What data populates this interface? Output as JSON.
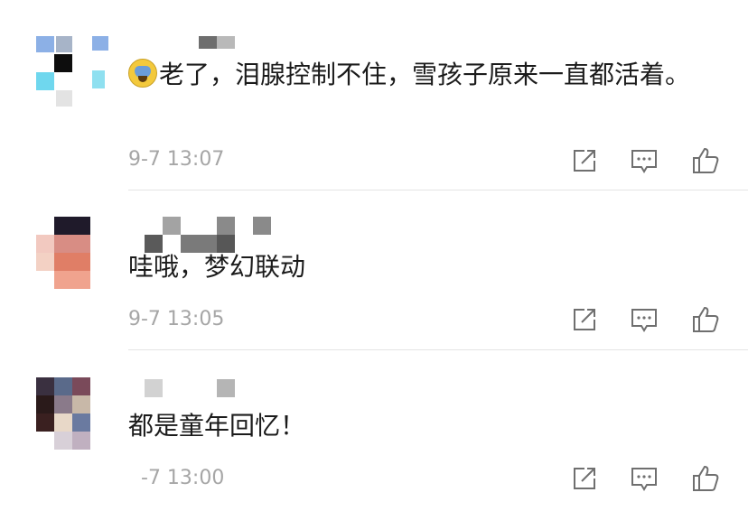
{
  "comments": [
    {
      "text": "老了，泪腺控制不住，雪孩子原来一直都活着。",
      "time": "9-7 13:07",
      "has_emoji": true,
      "emoji_icon": "crying-face-icon"
    },
    {
      "text": "哇哦，梦幻联动",
      "time": "9-7 13:05",
      "has_emoji": false
    },
    {
      "text": "都是童年回忆！",
      "time": "-7 13:00",
      "has_emoji": false
    }
  ],
  "action_icons": [
    "share-icon",
    "comment-icon",
    "like-icon"
  ]
}
